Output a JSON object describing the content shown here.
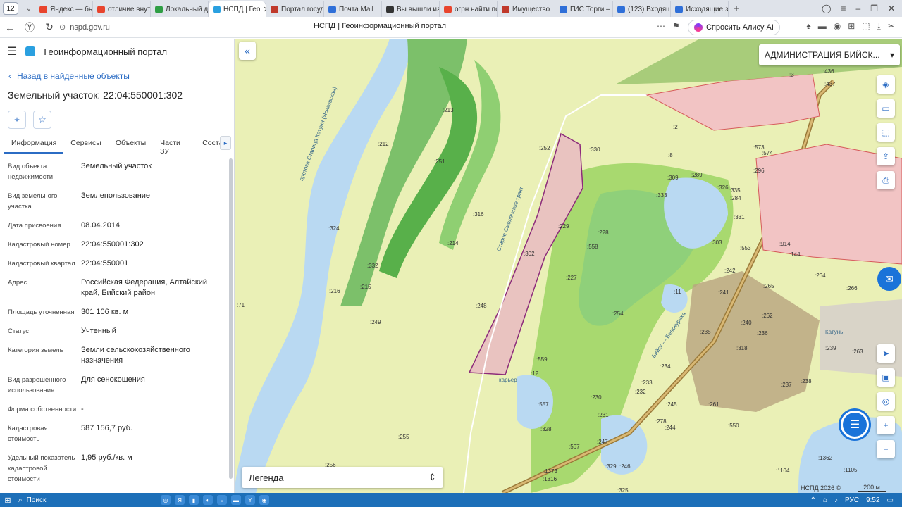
{
  "browser": {
    "tab_count": "12",
    "tabs": [
      {
        "label": "Яндекс — быс",
        "icon": "yandex-icon",
        "color": "#e8442d"
      },
      {
        "label": "отличие внут",
        "icon": "yandex-icon",
        "color": "#e8442d"
      },
      {
        "label": "Локальный д",
        "icon": "doc-icon",
        "color": "#2f9e44"
      },
      {
        "label": "НСПД | Гео",
        "icon": "nspd-icon",
        "color": "#2aa0e0",
        "active": true
      },
      {
        "label": "Портал госуд",
        "icon": "flag-icon",
        "color": "#c0392b"
      },
      {
        "label": "Почта Mail",
        "icon": "mail-icon",
        "color": "#2f6fd8"
      },
      {
        "label": "Вы вышли из",
        "icon": "shield-icon",
        "color": "#333333"
      },
      {
        "label": "огрн найти по",
        "icon": "yandex-icon",
        "color": "#e8442d"
      },
      {
        "label": "Имущество",
        "icon": "rts-icon",
        "color": "#c0392b"
      },
      {
        "label": "ГИС Торги – г",
        "icon": "gis-icon",
        "color": "#2f6fd8"
      },
      {
        "label": "(123) Входящ",
        "icon": "mail-icon",
        "color": "#2f6fd8"
      },
      {
        "label": "Исходящие з",
        "icon": "mail-icon",
        "color": "#2f6fd8"
      }
    ],
    "url": "nspd.gov.ru",
    "page_title": "НСПД | Геоинформационный портал",
    "alice_label": "Спросить Алису AI"
  },
  "panel": {
    "header_title": "Геоинформационный портал",
    "back_label": "Назад в найденные объекты",
    "object_title": "Земельный участок: 22:04:550001:302",
    "tabs": [
      "Информация",
      "Сервисы",
      "Объекты",
      "Части ЗУ",
      "Состав"
    ],
    "props": [
      {
        "k": "Вид объекта недвижимости",
        "v": "Земельный участок"
      },
      {
        "k": "Вид земельного участка",
        "v": "Землепользование"
      },
      {
        "k": "Дата присвоения",
        "v": "08.04.2014"
      },
      {
        "k": "Кадастровый номер",
        "v": "22:04:550001:302"
      },
      {
        "k": "Кадастровый квартал",
        "v": "22:04:550001"
      },
      {
        "k": "Адрес",
        "v": "Российская Федерация, Алтайский край, Бийский район"
      },
      {
        "k": "Площадь уточненная",
        "v": "301 106 кв. м"
      },
      {
        "k": "Статус",
        "v": "Учтенный"
      },
      {
        "k": "Категория земель",
        "v": "Земли сельскохозяйственного назначения"
      },
      {
        "k": "Вид разрешенного использования",
        "v": "Для сенокошения"
      },
      {
        "k": "Форма собственности",
        "v": "-"
      },
      {
        "k": "Кадастровая стоимость",
        "v": "587 156,7 руб."
      },
      {
        "k": "Удельный показатель кадастровой стоимости",
        "v": "1,95 руб./кв. м"
      }
    ]
  },
  "map": {
    "admin_select": "АДМИНИСТРАЦИЯ БИЙСК...",
    "legend_label": "Легенда",
    "copyright": "НСПД 2026 ©",
    "scale": "200 м",
    "labels": [
      ":213",
      ":212",
      ":251",
      ":316",
      ":252",
      ":330",
      ":2",
      ":8",
      ":302",
      ":229",
      ":228",
      ":558",
      ":214",
      ":324",
      ":332",
      ":216",
      ":215",
      ":249",
      ":248",
      ":227",
      ":254",
      ":11",
      ":559",
      ":12",
      ":557",
      ":230",
      ":231",
      ":233",
      ":232",
      ":234",
      ":328",
      ":255",
      ":256",
      ":71",
      ":309",
      ":289",
      ":333",
      ":326",
      ":335",
      ":284",
      ":331",
      ":303",
      ":242",
      ":241",
      ":265",
      ":266",
      ":240",
      ":262",
      ":236",
      ":235",
      ":318",
      ":261",
      ":245",
      ":237",
      ":238",
      ":239",
      ":263",
      ":278",
      ":244",
      ":550",
      ":247",
      ":246",
      ":329",
      ":1104",
      ":1105",
      ":1362",
      ":553",
      ":573",
      ":574",
      ":296",
      ":264",
      ":914",
      ":144",
      ":567",
      ":1373",
      ":1316",
      ":325",
      ":3",
      ":436",
      ":437"
    ],
    "place_labels": [
      "Старое Смоленское тракт",
      "протока Старица Катуни (Ясиковская)",
      "Бийск — Белокуриха",
      "Катунь",
      "карьер"
    ]
  },
  "taskbar": {
    "search_placeholder": "Поиск",
    "lang": "РУС",
    "time": "9:52"
  }
}
